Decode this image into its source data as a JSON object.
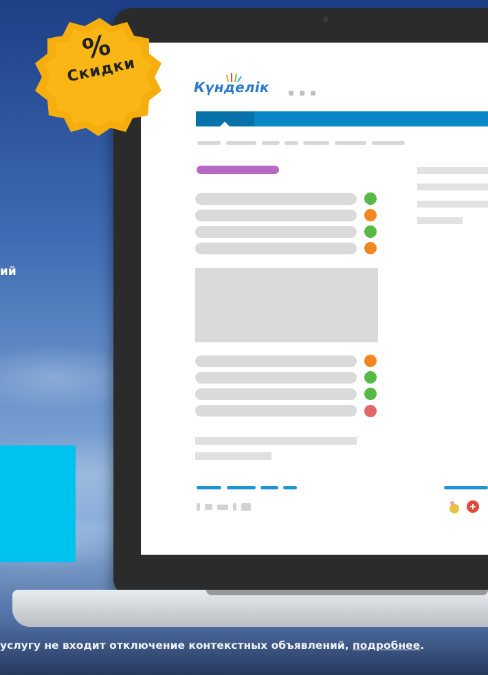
{
  "left_text": "ий",
  "badge": {
    "symbol": "%",
    "label": "Скидки"
  },
  "app": {
    "logo": "Күнделік"
  },
  "footer": {
    "text": "услугу не входит отключение контекстных объявлений, ",
    "link": "подробнее",
    "tail": "."
  },
  "colors": {
    "accent_blue": "#0a87c6",
    "purple": "#b66ac6",
    "green": "#58b947",
    "orange": "#f28722",
    "red": "#e36668",
    "badge": "#f6ae0f",
    "cyan": "#00c2ef"
  },
  "icons": [
    "message-icon",
    "user-icon",
    "bell-icon",
    "facebook-icon",
    "twitter-icon",
    "vk-icon",
    "odnoklassniki-icon",
    "youtube-icon",
    "badge-app-icon",
    "google-plus-icon"
  ]
}
